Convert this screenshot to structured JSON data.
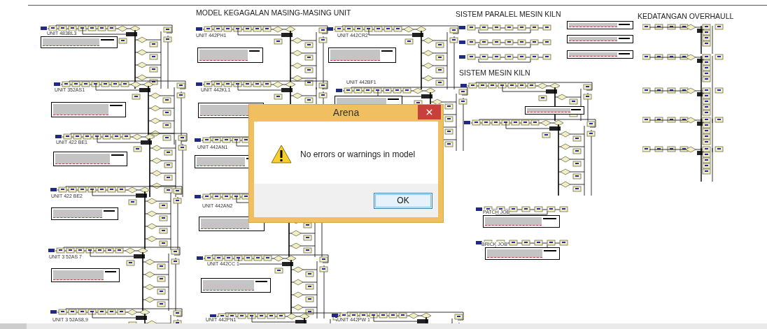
{
  "canvas": {
    "titles": [
      "MODEL KEGAGALAN MASING-MASING UNIT",
      "SISTEM PARALEL MESIN KILN",
      "SISTEM MESIN KILN",
      "KEDATANGAN OVERHAULL"
    ],
    "units": [
      {
        "label": "UNIT 483BL3"
      },
      {
        "label": "UNIT 352AS1"
      },
      {
        "label": "UNIT 422 BE1"
      },
      {
        "label": "UNIT 422 BE2"
      },
      {
        "label": "UNIT 3 52AS 7"
      },
      {
        "label": "UNIT 3 52AS8,9"
      },
      {
        "label": "UNIT 442PH1"
      },
      {
        "label": "UNIT 442KL1"
      },
      {
        "label": "UNIT 442AN1"
      },
      {
        "label": "UNIT 442AN2"
      },
      {
        "label": "UNIT 442CC 1"
      },
      {
        "label": "UNIT 442PN1"
      },
      {
        "label": "UNIT 442CR2"
      },
      {
        "label": "UNIT 442BF1"
      },
      {
        "label": "UNIT 442PW 1"
      }
    ],
    "jobs": [
      {
        "label": "PATCH JOB"
      },
      {
        "label": "BRICK JOB"
      }
    ]
  },
  "dialog": {
    "title": "Arena",
    "message": "No errors or warnings in model",
    "buttons": [
      "OK"
    ]
  }
}
